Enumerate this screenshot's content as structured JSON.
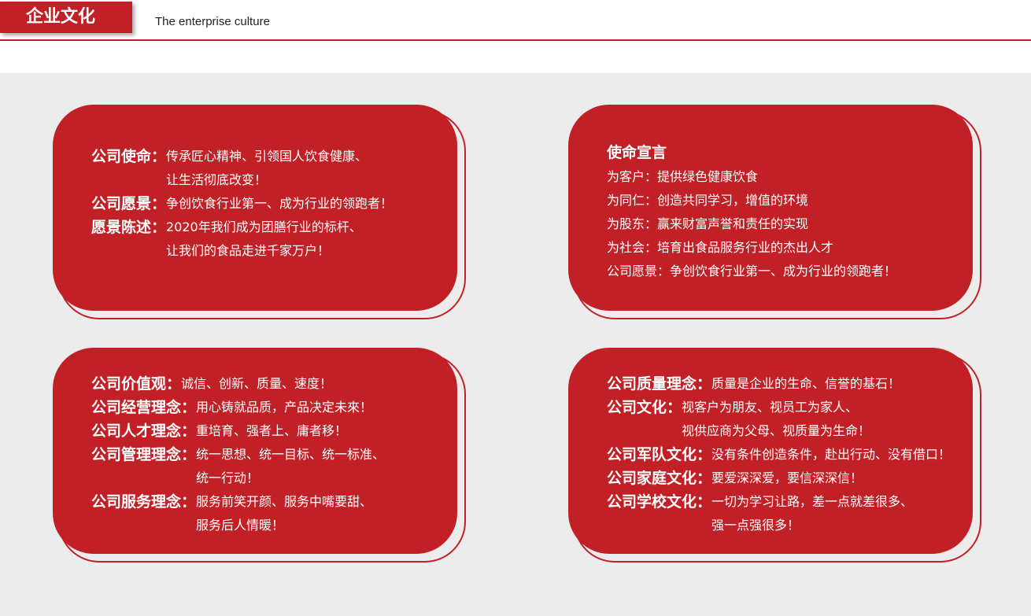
{
  "header": {
    "title": "企业文化",
    "subtitle": "The enterprise culture"
  },
  "card1": {
    "rows": [
      {
        "label": "公司使命：",
        "lines": [
          "传承匠心精神、引领国人饮食健康、",
          "让生活彻底改变！"
        ]
      },
      {
        "label": "公司愿景：",
        "lines": [
          "争创饮食行业第一、成为行业的领跑者！"
        ]
      },
      {
        "label": "愿景陈述：",
        "lines": [
          "2020年我们成为团膳行业的标杆、",
          "让我们的食品走进千家万户！"
        ]
      }
    ]
  },
  "card2": {
    "heading": "使命宣言",
    "lines": [
      "为客户：提供绿色健康饮食",
      "为同仁：创造共同学习，增值的环境",
      "为股东：赢来财富声誉和责任的实现",
      "为社会：培育出食品服务行业的杰出人才",
      "公司愿景：争创饮食行业第一、成为行业的领跑者！"
    ]
  },
  "card3": {
    "rows": [
      {
        "label": "公司价值观：",
        "lines": [
          "诚信、创新、质量、速度！"
        ]
      },
      {
        "label": "公司经营理念：",
        "lines": [
          "用心铸就品质，产品决定未來！"
        ]
      },
      {
        "label": "公司人才理念：",
        "lines": [
          "重培育、强者上、庸者移！"
        ]
      },
      {
        "label": "公司管理理念：",
        "lines": [
          "统一思想、统一目标、统一标准、",
          "统一行动！"
        ]
      },
      {
        "label": "公司服务理念：",
        "lines": [
          "服务前笑开颜、服务中嘴要甜、",
          "服务后人情暖！"
        ]
      }
    ]
  },
  "card4": {
    "rows": [
      {
        "label": "公司质量理念：",
        "lines": [
          "质量是企业的生命、信誉的基石！"
        ]
      },
      {
        "label": "公司文化：",
        "lines": [
          "视客户为朋友、视员工为家人、",
          "视供应商为父母、视质量为生命！"
        ]
      },
      {
        "label": "公司军队文化：",
        "lines": [
          "没有条件创造条件，赴出行动、没有借口！"
        ]
      },
      {
        "label": "公司家庭文化：",
        "lines": [
          "要爱深深爱，要信深深信！"
        ]
      },
      {
        "label": "公司学校文化：",
        "lines": [
          "一切为学习让路，差一点就差很多、",
          "强一点强很多！"
        ]
      }
    ]
  }
}
